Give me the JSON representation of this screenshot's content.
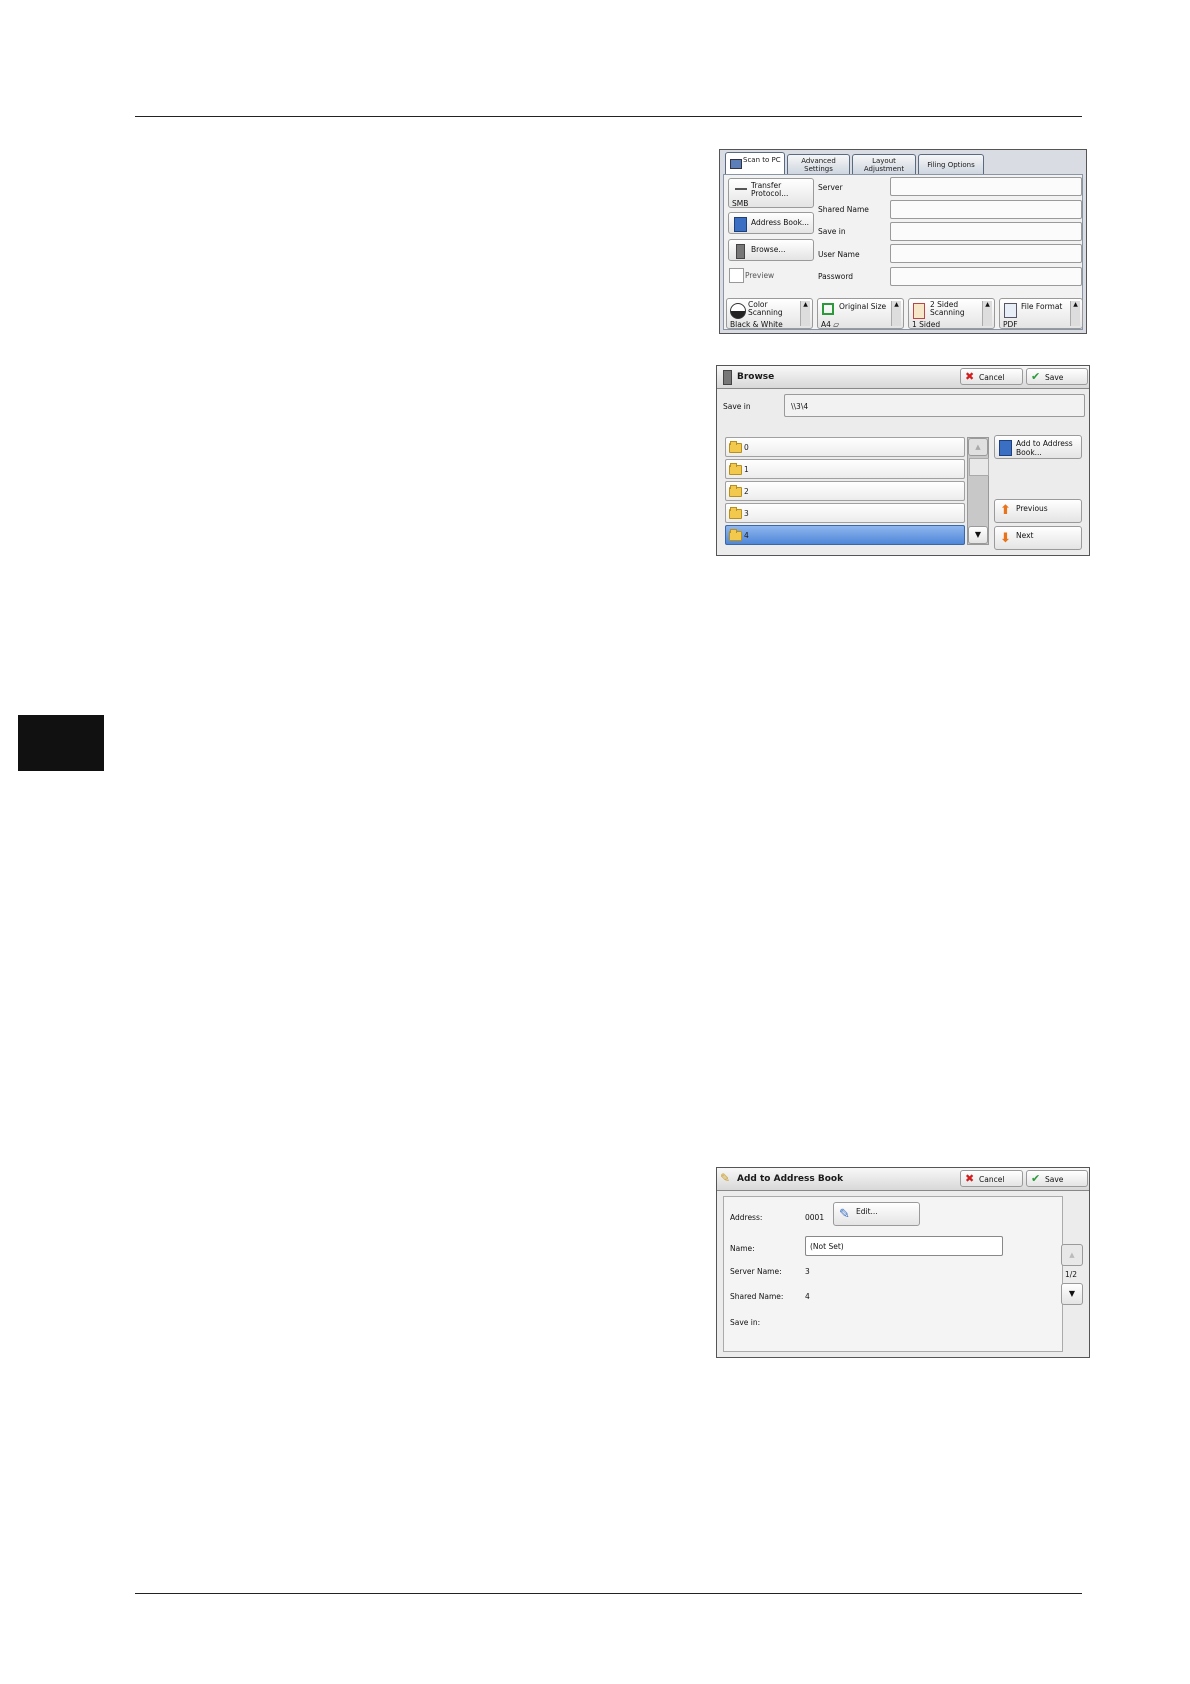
{
  "scan_panel": {
    "tabs": [
      "Scan to PC",
      "Advanced Settings",
      "Layout Adjustment",
      "Filing Options"
    ],
    "left_buttons": [
      {
        "label": "Transfer Protocol...",
        "value": "SMB"
      },
      {
        "label": "Address Book..."
      },
      {
        "label": "Browse..."
      },
      {
        "label": "Preview"
      }
    ],
    "fields": [
      "Server",
      "Shared Name",
      "Save in",
      "User Name",
      "Password"
    ],
    "bottom": [
      {
        "label": "Color Scanning",
        "value": "Black & White"
      },
      {
        "label": "Original Size",
        "value": "A4 ▱"
      },
      {
        "label": "2 Sided Scanning",
        "value": "1 Sided"
      },
      {
        "label": "File Format",
        "value": "PDF"
      }
    ]
  },
  "browse": {
    "title": "Browse",
    "cancel": "Cancel",
    "save": "Save",
    "save_in_label": "Save in",
    "save_in_value": "\\\\3\\4",
    "folders": [
      "0",
      "1",
      "2",
      "3",
      "4"
    ],
    "selected_folder": "4",
    "add_to_address_book": "Add to Address Book...",
    "previous": "Previous",
    "next": "Next"
  },
  "add_book": {
    "title": "Add to Address Book",
    "cancel": "Cancel",
    "save": "Save",
    "address_label": "Address:",
    "address_value": "0001",
    "edit": "Edit...",
    "name_label": "Name:",
    "name_value": "(Not Set)",
    "server_name_label": "Server Name:",
    "server_name_value": "3",
    "shared_name_label": "Shared Name:",
    "shared_name_value": "4",
    "save_in_label": "Save in:",
    "page": "1/2"
  }
}
